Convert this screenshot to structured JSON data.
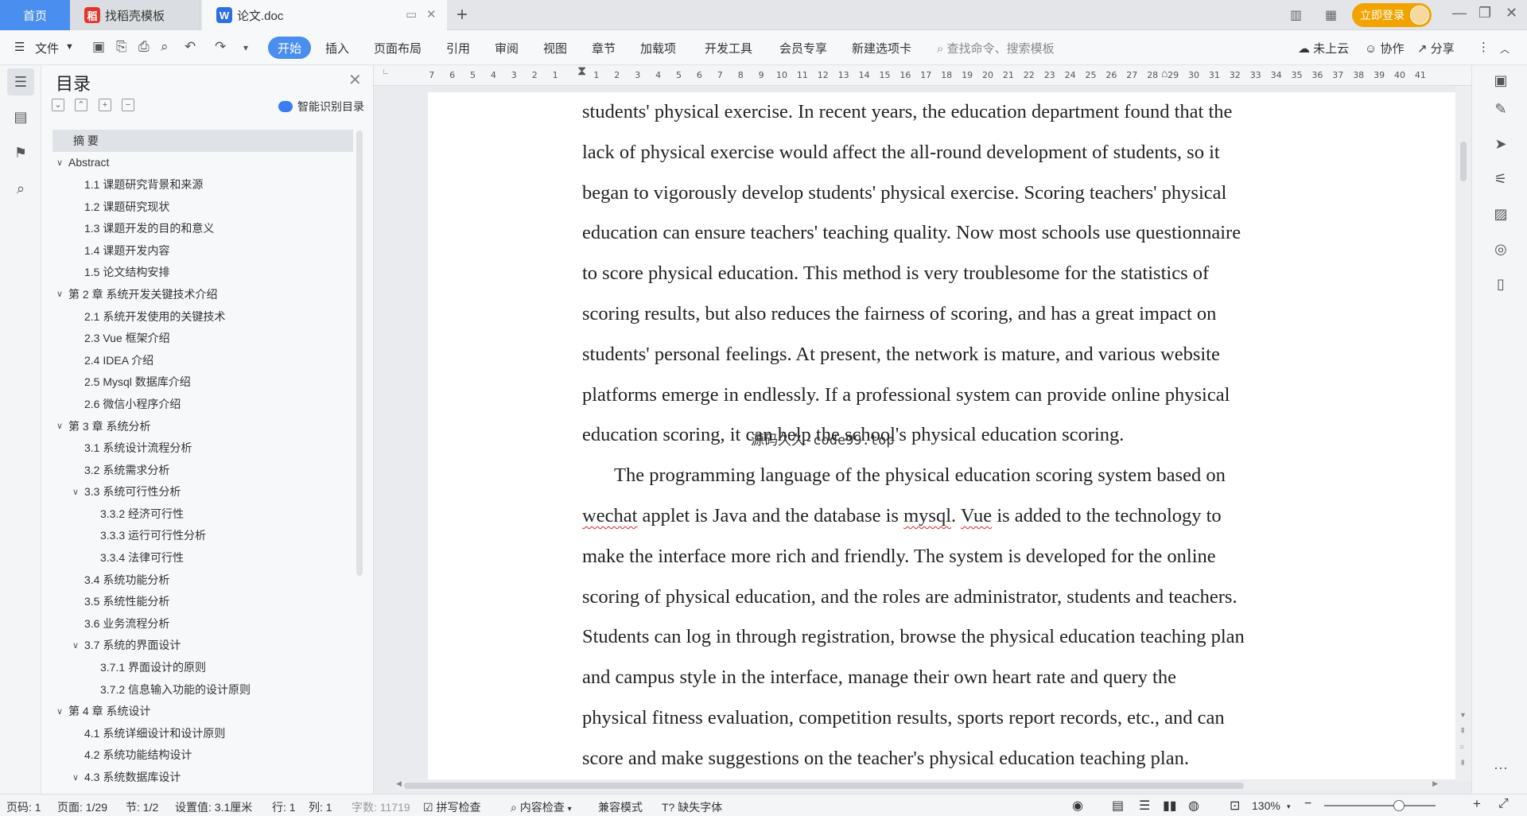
{
  "tabs": {
    "home": "首页",
    "template": "找稻壳模板",
    "doc": "论文.doc",
    "add": "+"
  },
  "account": {
    "login": "立即登录"
  },
  "ribbon": {
    "file": "文件",
    "tabs": [
      "开始",
      "插入",
      "页面布局",
      "引用",
      "审阅",
      "视图",
      "章节",
      "加载项",
      "开发工具",
      "会员专享",
      "新建选项卡"
    ],
    "search_placeholder": "查找命令、搜索模板",
    "cloud": "未上云",
    "collab": "协作",
    "share": "分享"
  },
  "toc": {
    "title": "目录",
    "smart": "智能识别目录",
    "items": [
      {
        "label": "摘 要",
        "level": 0,
        "chevron": false
      },
      {
        "label": "Abstract",
        "level": 0,
        "chevron": true
      },
      {
        "label": "1.1 课题研究背景和来源",
        "level": 1,
        "chevron": false
      },
      {
        "label": "1.2 课题研究现状",
        "level": 1,
        "chevron": false
      },
      {
        "label": "1.3 课题开发的目的和意义",
        "level": 1,
        "chevron": false
      },
      {
        "label": "1.4 课题开发内容",
        "level": 1,
        "chevron": false
      },
      {
        "label": "1.5 论文结构安排",
        "level": 1,
        "chevron": false
      },
      {
        "label": "第 2 章  系统开发关键技术介绍",
        "level": 0,
        "chevron": true
      },
      {
        "label": "2.1 系统开发使用的关键技术",
        "level": 1,
        "chevron": false
      },
      {
        "label": "2.3 Vue 框架介绍",
        "level": 1,
        "chevron": false
      },
      {
        "label": "2.4 IDEA 介绍",
        "level": 1,
        "chevron": false
      },
      {
        "label": "2.5 Mysql 数据库介绍",
        "level": 1,
        "chevron": false
      },
      {
        "label": "2.6 微信小程序介绍",
        "level": 1,
        "chevron": false
      },
      {
        "label": "第 3 章  系统分析",
        "level": 0,
        "chevron": true
      },
      {
        "label": "3.1 系统设计流程分析",
        "level": 1,
        "chevron": false
      },
      {
        "label": "3.2 系统需求分析",
        "level": 1,
        "chevron": false
      },
      {
        "label": "3.3 系统可行性分析",
        "level": 1,
        "chevron": true
      },
      {
        "label": "3.3.2 经济可行性",
        "level": 2,
        "chevron": false
      },
      {
        "label": "3.3.3 运行可行性分析",
        "level": 2,
        "chevron": false
      },
      {
        "label": "3.3.4 法律可行性",
        "level": 2,
        "chevron": false
      },
      {
        "label": "3.4 系统功能分析",
        "level": 1,
        "chevron": false
      },
      {
        "label": "3.5 系统性能分析",
        "level": 1,
        "chevron": false
      },
      {
        "label": "3.6 业务流程分析",
        "level": 1,
        "chevron": false
      },
      {
        "label": "3.7 系统的界面设计",
        "level": 1,
        "chevron": true
      },
      {
        "label": "3.7.1 界面设计的原则",
        "level": 2,
        "chevron": false
      },
      {
        "label": "3.7.2 信息输入功能的设计原则",
        "level": 2,
        "chevron": false
      },
      {
        "label": "第 4 章  系统设计",
        "level": 0,
        "chevron": true
      },
      {
        "label": "4.1 系统详细设计和设计原则",
        "level": 1,
        "chevron": false
      },
      {
        "label": "4.2 系统功能结构设计",
        "level": 1,
        "chevron": false
      },
      {
        "label": "4.3 系统数据库设计",
        "level": 1,
        "chevron": true
      }
    ]
  },
  "ruler": {
    "left": [
      "7",
      "6",
      "5",
      "4",
      "3",
      "2",
      "1"
    ],
    "right": [
      "1",
      "2",
      "3",
      "4",
      "5",
      "6",
      "7",
      "8",
      "9",
      "10",
      "11",
      "12",
      "13",
      "14",
      "15",
      "16",
      "17",
      "18",
      "19",
      "20",
      "21",
      "22",
      "23",
      "24",
      "25",
      "26",
      "27",
      "28",
      "29",
      "30",
      "31",
      "32",
      "33",
      "34",
      "35",
      "36",
      "37",
      "38",
      "39",
      "40",
      "41"
    ]
  },
  "document": {
    "lines": [
      {
        "text": "students' physical exercise. In recent years, the education department found that the"
      },
      {
        "text": "lack of physical exercise would affect the all-round development of students, so it"
      },
      {
        "text": "began to vigorously develop students' physical exercise. Scoring teachers' physical"
      },
      {
        "text": "education can ensure teachers' teaching quality. Now most schools use questionnaire"
      },
      {
        "text": "to score physical education. This method is very troublesome for the statistics of"
      },
      {
        "text": "scoring results, but also reduces the fairness of scoring, and has a great impact on"
      },
      {
        "text": "students' personal feelings. At present, the network is mature, and various website"
      },
      {
        "text": "platforms emerge in endlessly. If a professional system can provide online physical"
      },
      {
        "text": "education scoring, it can help the school's physical education scoring."
      },
      {
        "text": "The programming language of the physical education scoring system based on",
        "indent": true
      },
      {
        "parts": [
          "wechat",
          " applet is Java and the database is ",
          "mysql",
          ". ",
          "Vue",
          " is added to the technology to"
        ]
      },
      {
        "text": "make the interface more rich and friendly. The system is developed for the online"
      },
      {
        "text": "scoring of physical education, and the roles are administrator, students and teachers."
      },
      {
        "text": "Students can log in through registration, browse the physical education teaching plan"
      },
      {
        "text": "and campus style in the interface, manage their own heart rate and query the"
      },
      {
        "text": "physical fitness evaluation, competition results, sports report records, etc., and can"
      },
      {
        "text": "score and make suggestions on the teacher's physical education teaching plan."
      }
    ],
    "watermark": "源码久久-code99.top"
  },
  "status": {
    "page_code": "页码: 1",
    "pages": "页面: 1/29",
    "section": "节: 1/2",
    "setting": "设置值: 3.1厘米",
    "row": "行: 1",
    "col": "列: 1",
    "words": "字数: 11719",
    "spell": "拼写检查",
    "content": "内容检查",
    "compat": "兼容模式",
    "missing_font": "缺失字体",
    "zoom": "130%"
  }
}
